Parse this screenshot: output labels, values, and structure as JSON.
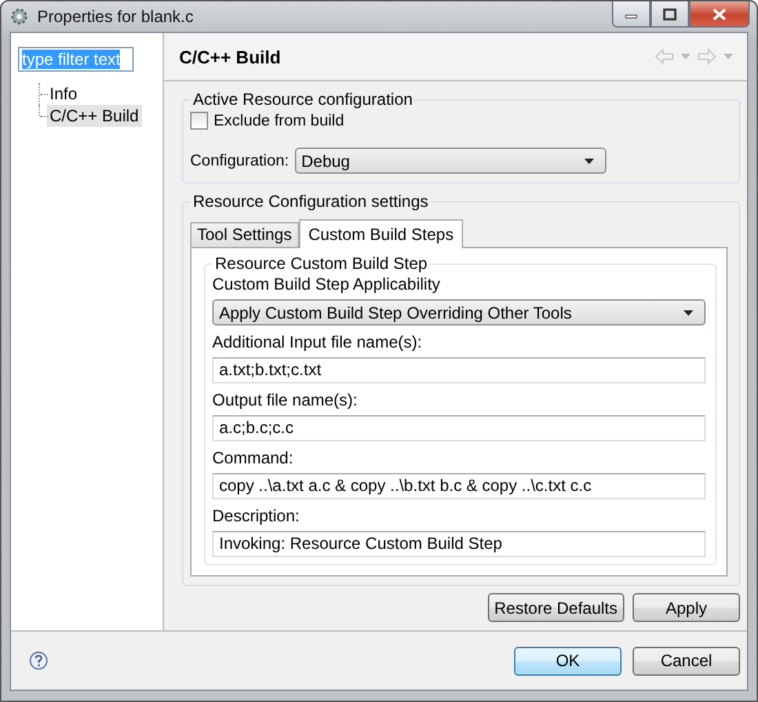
{
  "window": {
    "title": "Properties for blank.c"
  },
  "sidebar": {
    "filter": {
      "value": "type filter text",
      "text_selected": true
    },
    "items": [
      {
        "label": "Info",
        "selected": false
      },
      {
        "label": "C/C++ Build",
        "selected": true
      }
    ]
  },
  "page": {
    "title": "C/C++ Build"
  },
  "active_configuration": {
    "title": "Active Resource configuration",
    "exclude": {
      "label": "Exclude from build",
      "checked": false
    },
    "configuration": {
      "label": "Configuration:",
      "value": "Debug"
    }
  },
  "settings": {
    "title": "Resource Configuration settings",
    "tabs": [
      {
        "label": "Tool Settings",
        "selected": false
      },
      {
        "label": "Custom Build Steps",
        "selected": true
      }
    ],
    "step": {
      "title": "Resource Custom Build Step",
      "applicability": {
        "label": "Custom Build Step Applicability",
        "value": "Apply Custom Build Step Overriding Other Tools"
      },
      "fields": [
        {
          "label": "Additional Input file name(s):",
          "value": "a.txt;b.txt;c.txt"
        },
        {
          "label": "Output file name(s):",
          "value": "a.c;b.c;c.c"
        },
        {
          "label": "Command:",
          "value": "copy ..\\a.txt a.c & copy ..\\b.txt b.c & copy ..\\c.txt c.c"
        },
        {
          "label": "Description:",
          "value": "Invoking: Resource Custom Build Step"
        }
      ]
    }
  },
  "page_buttons": [
    {
      "label": "Restore Defaults"
    },
    {
      "label": "Apply"
    }
  ],
  "dialog_buttons": [
    {
      "label": "OK",
      "default": true
    },
    {
      "label": "Cancel",
      "default": false
    }
  ]
}
